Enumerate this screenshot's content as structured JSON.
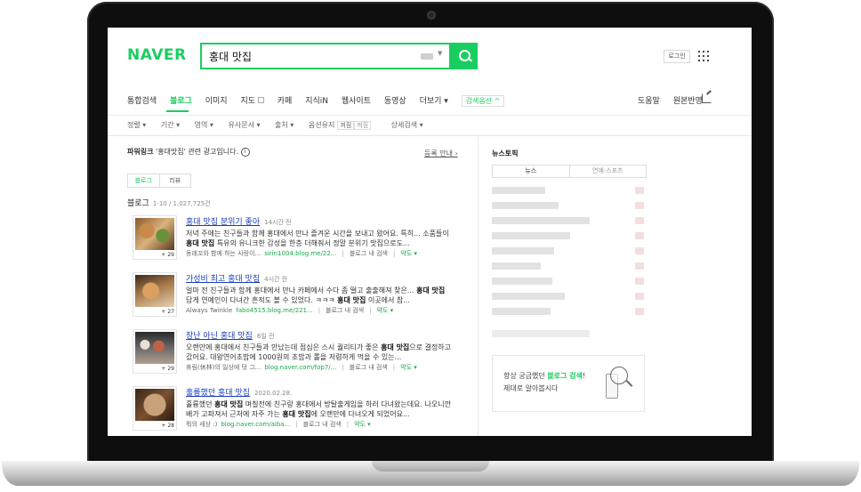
{
  "header": {
    "logo": "NAVER",
    "query": "홍대 맛집",
    "login_label": "로그인"
  },
  "nav": {
    "tabs": [
      "통합검색",
      "블로그",
      "이미지",
      "지도",
      "카페",
      "지식iN",
      "웹사이트",
      "동영상",
      "더보기 ▾",
      "검색옵션 ^"
    ],
    "active_tab": "블로그",
    "right": [
      "도움말",
      "원본반영"
    ]
  },
  "filters": {
    "items": [
      "정렬 ▾",
      "기간 ▾",
      "영역 ▾",
      "유사문서 ▾",
      "출처 ▾",
      "옵션유지",
      "상세검색 ▾"
    ],
    "chips": [
      "꺼짐",
      "켜짐"
    ]
  },
  "powerlink": {
    "label": "파워링크",
    "suffix": "'홍대맛집' 관련 광고입니다.",
    "register": "등록 안내 ›"
  },
  "subtabs": [
    "블로그",
    "리뷰"
  ],
  "blog": {
    "label": "블로그",
    "count": "1-10 / 1,027,725건",
    "items": [
      {
        "title": "홍대 맛집 분위기 좋아",
        "date": "14시간 전",
        "desc1": "저녁 주에는 친구들과 함께 홍대에서 만나 즐겨운 시간을 보내고 왔어요. 특히... 소품들이",
        "desc2": "홍대 맛집 특유의 유니크한 감성을 한층 더해줘서 정말 분위기 맛집으로도...",
        "author": "동래꼬와 함께 하는 사랑이...",
        "url": "sirin1004.blog.me/22...",
        "in_blog": "블로그 내 검색",
        "map": "약도 ▾",
        "count": "+ 29"
      },
      {
        "title": "가성비 최고 홍대 맛집",
        "date": "4시간 전",
        "desc1": "얼마 전 친구들과 함께 홍대에서 만나 카페에서 수다 좀 떨고 출출해져 찾은... 홍대 맛집",
        "desc2": "답게 연예인이 다녀간 흔적도 볼 수 있었다. ㅋㅋㅋ 홍대 맛집 이곳에서 참...",
        "author": "Always Twinkle",
        "url": "fabo4515.blog.me/221...",
        "in_blog": "블로그 내 검색",
        "map": "약도 ▾",
        "count": "+ 27"
      },
      {
        "title": "장난 아닌 홍대 맛집",
        "date": "6일 전",
        "desc1": "오랜만에 홍대에서 친구들과 만났는데 점심은 스시 퀄리티가 좋은 홍대 맛집으로 결정하고",
        "desc2": "갔어요. 대왕연어초밥에 1000원의 초밥과 롤을 저렴하게 먹을 수 있는...",
        "author": "휴림(休林)의 일상에 덧 그...",
        "url": "blog.naver.com/fop7/...",
        "in_blog": "블로그 내 검색",
        "map": "약도 ▾",
        "count": "+ 29"
      },
      {
        "title": "훌륭했던 홍대 맛집",
        "date": "2020.02.28.",
        "desc1": "훌륭했던 홍대 맛집 며칠전에 친구랑 홍대에서 방탈출게임을 하러 다녀왔는데요. 나오니깐",
        "desc2": "배가 고파져서 근처에 자주 가는 홍대 맛집에 오랜만에 다녀오게 되었어요...",
        "author": "뭐의 세상 :)",
        "url": "blog.naver.com/aiba...",
        "in_blog": "블로그 내 검색",
        "map": "약도 ▾",
        "count": "+ 28"
      }
    ]
  },
  "sidebar": {
    "newstopic": "뉴스토픽",
    "tabs": [
      "뉴스",
      "연예·스포츠"
    ],
    "promo_line1_pre": "항상 궁금했던 ",
    "promo_line1_em": "블로그 검색",
    "promo_line1_post": "!",
    "promo_line2": "제대로 알아봅시다"
  },
  "colors": {
    "brand": "#19ce60",
    "link": "#1a3db8"
  }
}
